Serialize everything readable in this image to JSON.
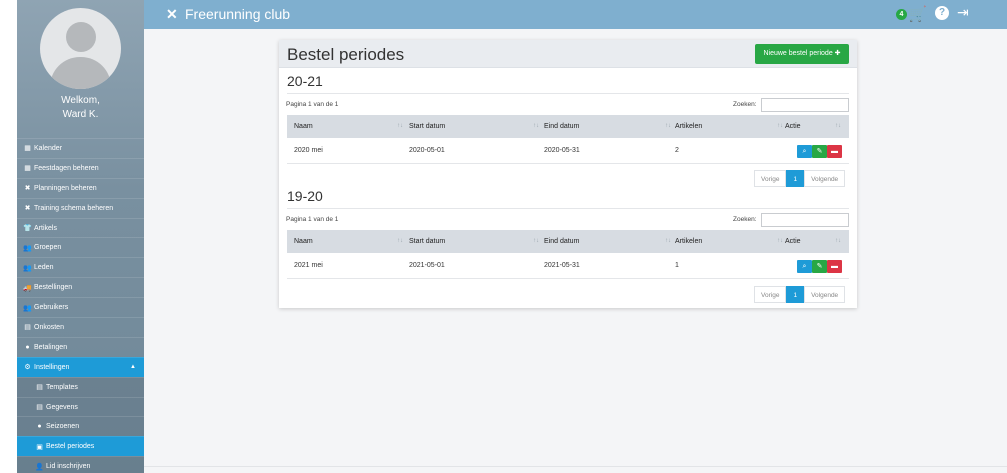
{
  "app": {
    "title": "Freerunning club",
    "cart_count": "4"
  },
  "icons": {
    "close": "close-icon",
    "cart": "cart-icon",
    "help": "help-icon",
    "logout": "logout-icon",
    "view": "search-icon",
    "edit": "edit-icon",
    "delete": "trash-icon"
  },
  "colors": {
    "topbar": "#7fafcf",
    "active": "#1e9bd7",
    "success": "#28a745",
    "danger": "#dc3545"
  },
  "sidebar": {
    "welcome": "Welkom,",
    "user": "Ward K.",
    "items": [
      {
        "label": "Kalender",
        "icon": "▦"
      },
      {
        "label": "Feestdagen beheren",
        "icon": "▦"
      },
      {
        "label": "Planningen beheren",
        "icon": "✖"
      },
      {
        "label": "Training schema beheren",
        "icon": "✖"
      },
      {
        "label": "Artikels",
        "icon": "👕"
      },
      {
        "label": "Groepen",
        "icon": "👥"
      },
      {
        "label": "Leden",
        "icon": "👥"
      },
      {
        "label": "Bestellingen",
        "icon": "🚚"
      },
      {
        "label": "Gebruikers",
        "icon": "👥"
      },
      {
        "label": "Onkosten",
        "icon": "▤"
      },
      {
        "label": "Betalingen",
        "icon": "●"
      },
      {
        "label": "Instellingen",
        "icon": "⚙",
        "chevron": "▲"
      }
    ],
    "subitems": [
      {
        "label": "Templates",
        "icon": "▤"
      },
      {
        "label": "Gegevens",
        "icon": "▤"
      },
      {
        "label": "Seizoenen",
        "icon": "●"
      },
      {
        "label": "Bestel periodes",
        "icon": "▣"
      },
      {
        "label": "Lid inschrijven",
        "icon": "👤"
      }
    ]
  },
  "page": {
    "title": "Bestel periodes",
    "new_button": "Nieuwe bestel periode ✚",
    "table_labels": {
      "pageinfo": "Pagina 1 van de 1",
      "search_label": "Zoeken:",
      "columns": [
        "Naam",
        "Start datum",
        "Eind datum",
        "Artikelen",
        "Actie"
      ],
      "pager": {
        "prev": "Vorige",
        "current": "1",
        "next": "Volgende"
      }
    },
    "sections": [
      {
        "title": "20-21",
        "rows": [
          {
            "name": "2020 mei",
            "start": "2020-05-01",
            "end": "2020-05-31",
            "items": "2"
          }
        ]
      },
      {
        "title": "19-20",
        "rows": [
          {
            "name": "2021 mei",
            "start": "2021-05-01",
            "end": "2021-05-31",
            "items": "1"
          }
        ]
      }
    ]
  }
}
